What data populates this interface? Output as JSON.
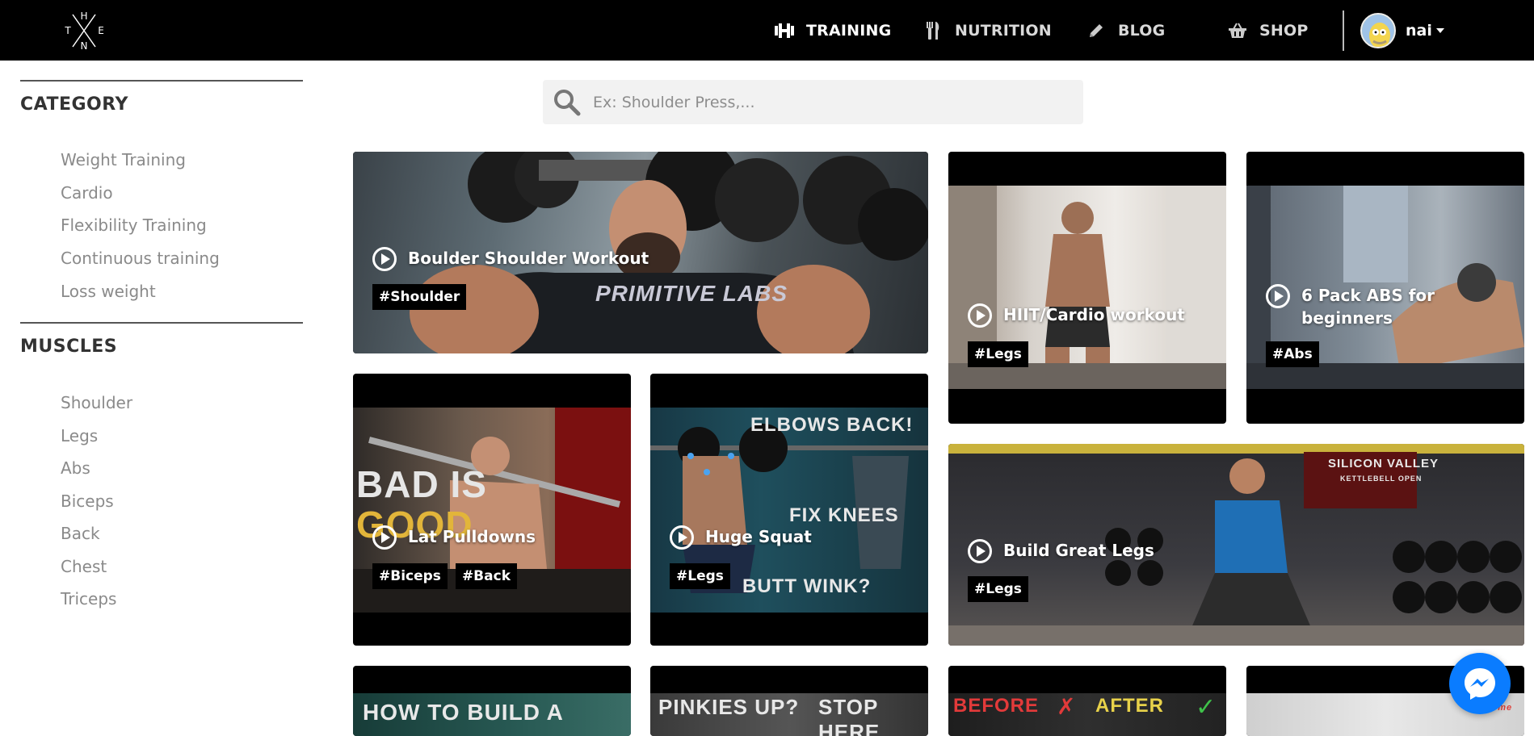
{
  "header": {
    "logo_letters": [
      "H",
      "T",
      "E",
      "N"
    ],
    "nav": [
      {
        "label": "TRAINING",
        "icon": "dumbbell-icon"
      },
      {
        "label": "NUTRITION",
        "icon": "fork-knife-icon"
      },
      {
        "label": "BLOG",
        "icon": "pencil-icon"
      },
      {
        "label": "SHOP",
        "icon": "basket-icon"
      }
    ],
    "username": "nai"
  },
  "sidebar": {
    "category_heading": "CATEGORY",
    "categories": [
      "Weight Training",
      "Cardio",
      "Flexibility Training",
      "Continuous training",
      "Loss weight"
    ],
    "muscles_heading": "MUSCLES",
    "muscles": [
      "Shoulder",
      "Legs",
      "Abs",
      "Biceps",
      "Back",
      "Chest",
      "Triceps"
    ]
  },
  "search": {
    "placeholder": "Ex: Shoulder Press,..."
  },
  "workouts": [
    {
      "title": "Boulder Shoulder Workout",
      "tags": [
        "#Shoulder"
      ],
      "thumb_text": "PRIMITIVE LABS"
    },
    {
      "title": "HIIT/Cardio workout",
      "tags": [
        "#Legs"
      ]
    },
    {
      "title": "6 Pack ABS for beginners",
      "tags": [
        "#Abs"
      ]
    },
    {
      "title": "Lat Pulldowns",
      "tags": [
        "#Biceps",
        "#Back"
      ],
      "thumb_text": [
        "BAD IS",
        "GOOD"
      ]
    },
    {
      "title": "Huge Squat",
      "tags": [
        "#Legs"
      ],
      "thumb_text": [
        "ELBOWS BACK!",
        "FIX KNEES",
        "BUTT WINK?"
      ]
    },
    {
      "title": "Build Great Legs",
      "tags": [
        "#Legs"
      ],
      "thumb_text": [
        "SILICON VALLEY",
        "KETTLEBELL OPEN"
      ]
    }
  ],
  "partial_cards": [
    {
      "thumb_text": "HOW TO BUILD A"
    },
    {
      "thumb_text": [
        "PINKIES UP?",
        "STOP HERE"
      ]
    },
    {
      "thumb_text": [
        "BEFORE",
        "AFTER"
      ]
    },
    {
      "thumb_text": "at home"
    }
  ],
  "colors": {
    "header_bg": "#000000",
    "messenger_blue": "#0a7cff",
    "sidebar_text": "#8a8a8a"
  }
}
